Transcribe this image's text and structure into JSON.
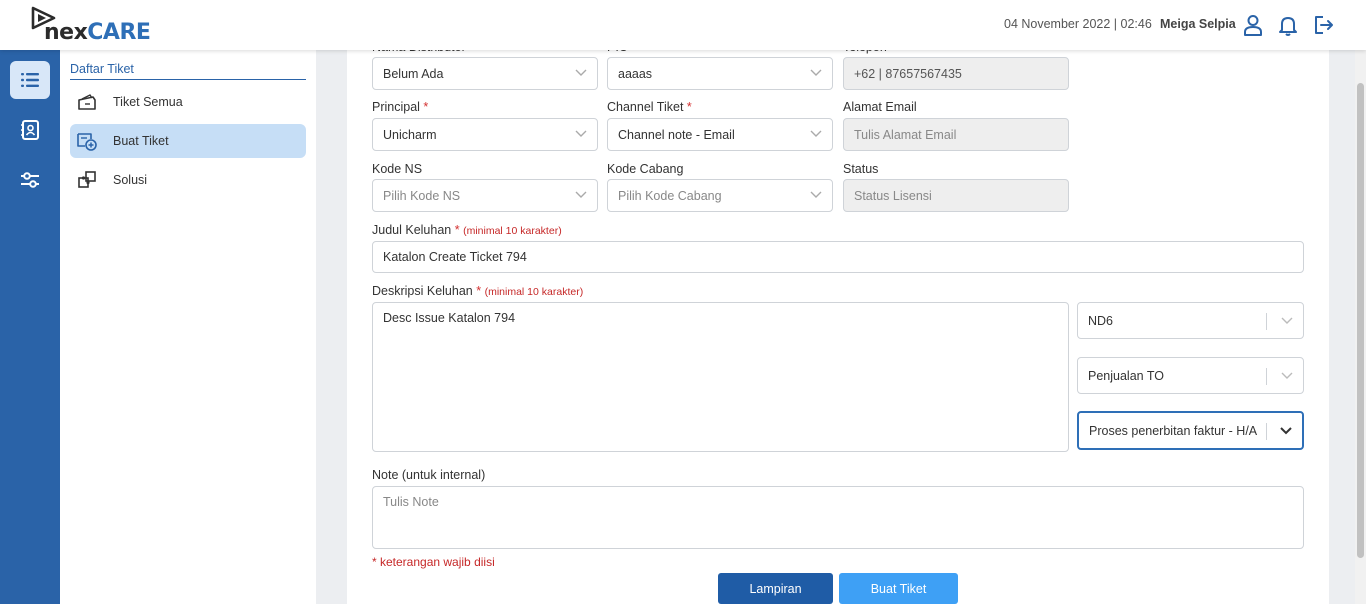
{
  "brand": {
    "name_part1": "nex",
    "name_part2": "CARE"
  },
  "header": {
    "datetime": "04 November 2022 | 02:46",
    "user_name": "Meiga Selpia"
  },
  "sidebar": {
    "title": "Daftar Tiket",
    "items": [
      {
        "label": "Tiket Semua",
        "icon": "ticket-icon",
        "active": false
      },
      {
        "label": "Buat Tiket",
        "icon": "ticket-add-icon",
        "active": true
      },
      {
        "label": "Solusi",
        "icon": "puzzle-icon",
        "active": false
      }
    ]
  },
  "rail": [
    {
      "icon": "list-icon",
      "active": true
    },
    {
      "icon": "contact-book-icon",
      "active": false
    },
    {
      "icon": "sliders-icon",
      "active": false
    }
  ],
  "form": {
    "nama_distributor": {
      "label": "Nama Distributor",
      "value": "Belum Ada"
    },
    "pic": {
      "label": "PIC",
      "value": "aaaas"
    },
    "telepon": {
      "label": "Telepon",
      "value": "+62 | 87657567435"
    },
    "principal": {
      "label": "Principal",
      "req": "*",
      "value": "Unicharm"
    },
    "channel_tiket": {
      "label": "Channel Tiket",
      "req": "*",
      "value": "Channel note - Email"
    },
    "alamat_email": {
      "label": "Alamat Email",
      "placeholder": "Tulis Alamat Email"
    },
    "kode_ns": {
      "label": "Kode NS",
      "placeholder": "Pilih Kode NS"
    },
    "kode_cabang": {
      "label": "Kode Cabang",
      "placeholder": "Pilih Kode Cabang"
    },
    "status": {
      "label": "Status",
      "placeholder": "Status Lisensi"
    },
    "judul": {
      "label": "Judul Keluhan",
      "req": "*",
      "hint": "(minimal 10 karakter)",
      "value": "Katalon Create Ticket 794"
    },
    "deskripsi": {
      "label": "Deskripsi Keluhan",
      "req": "*",
      "hint": "(minimal 10 karakter)",
      "value": "Desc Issue Katalon 794"
    },
    "category_1": "ND6",
    "category_2": "Penjualan TO",
    "category_3": "Proses penerbitan faktur - H/A",
    "note": {
      "label": "Note (untuk internal)",
      "placeholder": "Tulis Note"
    },
    "required_note": "* keterangan wajib diisi"
  },
  "buttons": {
    "lampiran": "Lampiran",
    "buat_tiket": "Buat Tiket"
  },
  "colors": {
    "primary": "#2a63a8",
    "accent": "#3ea0f5",
    "required": "#d32f2f"
  }
}
